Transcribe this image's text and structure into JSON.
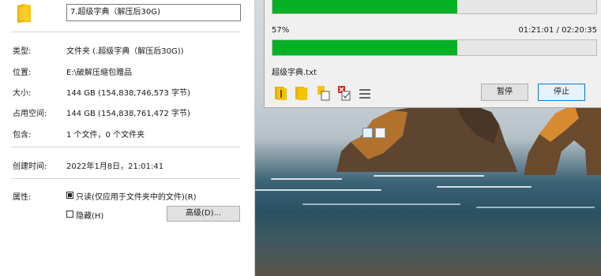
{
  "properties": {
    "folder_name": "7.超级字典（解压后30G)",
    "rows": [
      {
        "label": "类型:",
        "value": "文件夹 (.超级字典（解压后30G))"
      },
      {
        "label": "位置:",
        "value": "E:\\破解压缩包赠品"
      },
      {
        "label": "大小:",
        "value": "144 GB (154,838,746,573 字节)"
      },
      {
        "label": "占用空间:",
        "value": "144 GB (154,838,761,472 字节)"
      },
      {
        "label": "包含:",
        "value": "1 个文件，0 个文件夹"
      },
      {
        "label": "创建时间:",
        "value": "2022年1月8日，21:01:41"
      }
    ],
    "attributes_label": "属性:",
    "readonly_label": "只读(仅应用于文件夹中的文件)(R)",
    "readonly_checked": true,
    "hidden_label": "隐藏(H)",
    "hidden_checked": false,
    "advanced_button": "高级(D)..."
  },
  "extract": {
    "top_progress": 0.57,
    "percent_text": "57%",
    "times_text": "01:21:01 / 02:20:35",
    "file_progress": 0.57,
    "current_file": "超级字典.txt",
    "pause_button": "暂停",
    "stop_button": "停止",
    "toolbar_icons": [
      "open-folder-icon",
      "folder-icon",
      "copy-icon",
      "delete-check-icon",
      "menu-icon"
    ]
  },
  "colors": {
    "progress_green": "#06b025",
    "folder_yellow": "#f5c400"
  }
}
